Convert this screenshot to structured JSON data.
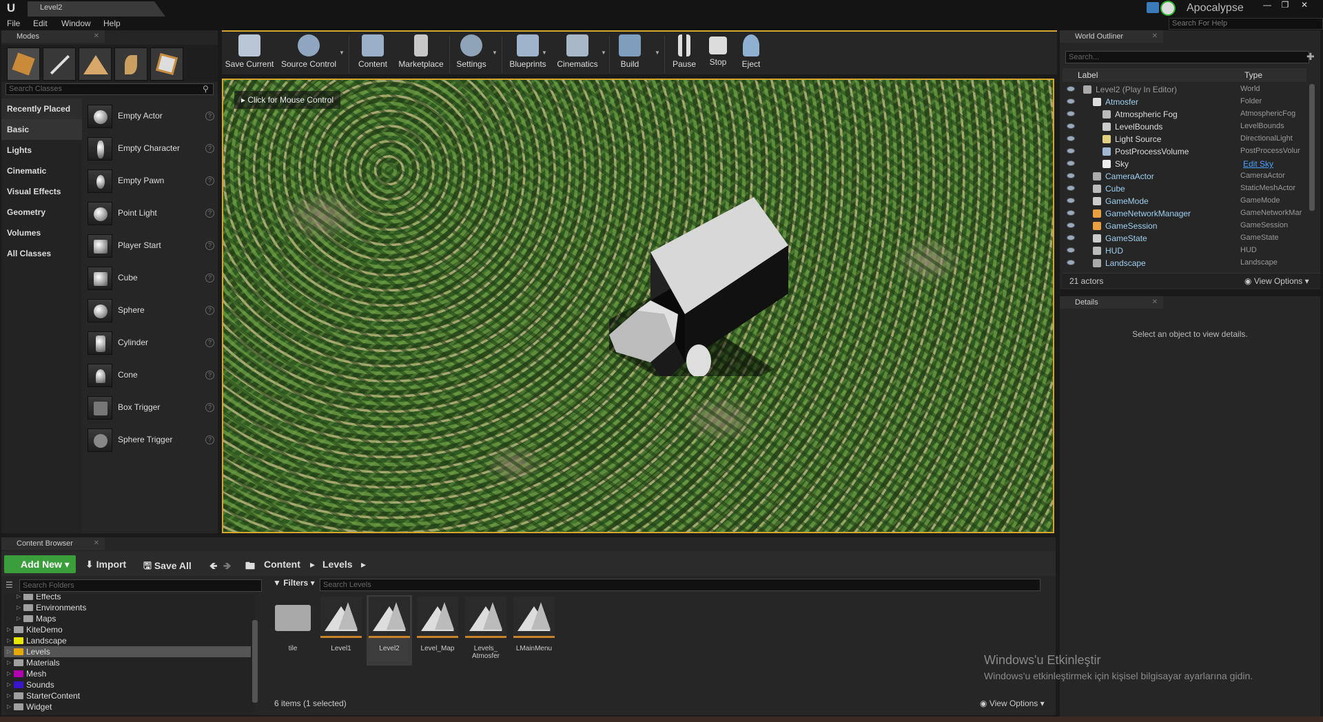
{
  "titlebar": {
    "level_tab": "Level2",
    "project": "Apocalypse",
    "help_search_placeholder": "Search For Help"
  },
  "menu": [
    "File",
    "Edit",
    "Window",
    "Help"
  ],
  "modes": {
    "tab": "Modes",
    "search_placeholder": "Search Classes",
    "categories": [
      "Recently Placed",
      "Basic",
      "Lights",
      "Cinematic",
      "Visual Effects",
      "Geometry",
      "Volumes",
      "All Classes"
    ],
    "selected_category": "Basic",
    "items": [
      "Empty Actor",
      "Empty Character",
      "Empty Pawn",
      "Point Light",
      "Player Start",
      "Cube",
      "Sphere",
      "Cylinder",
      "Cone",
      "Box Trigger",
      "Sphere Trigger"
    ]
  },
  "toolbar": [
    "Save Current",
    "Source Control",
    "Content",
    "Marketplace",
    "Settings",
    "Blueprints",
    "Cinematics",
    "Build",
    "Pause",
    "Stop",
    "Eject"
  ],
  "viewport": {
    "hint": "Click for Mouse Control"
  },
  "outliner": {
    "tab": "World Outliner",
    "search_placeholder": "Search...",
    "col_label": "Label",
    "col_type": "Type",
    "rows": [
      {
        "label": "Level2 (Play In Editor)",
        "type": "World",
        "indent": 0
      },
      {
        "label": "Atmosfer",
        "type": "Folder",
        "indent": 1
      },
      {
        "label": "Atmospheric Fog",
        "type": "AtmosphericFog",
        "indent": 2
      },
      {
        "label": "LevelBounds",
        "type": "LevelBounds",
        "indent": 2
      },
      {
        "label": "Light Source",
        "type": "DirectionalLight",
        "indent": 2
      },
      {
        "label": "PostProcessVolume",
        "type": "PostProcessVolur",
        "indent": 2
      },
      {
        "label": "Sky",
        "type": "Edit Sky",
        "indent": 2
      },
      {
        "label": "CameraActor",
        "type": "CameraActor",
        "indent": 1
      },
      {
        "label": "Cube",
        "type": "StaticMeshActor",
        "indent": 1
      },
      {
        "label": "GameMode",
        "type": "GameMode",
        "indent": 1
      },
      {
        "label": "GameNetworkManager",
        "type": "GameNetworkMar",
        "indent": 1
      },
      {
        "label": "GameSession",
        "type": "GameSession",
        "indent": 1
      },
      {
        "label": "GameState",
        "type": "GameState",
        "indent": 1
      },
      {
        "label": "HUD",
        "type": "HUD",
        "indent": 1
      },
      {
        "label": "Landscape",
        "type": "Landscape",
        "indent": 1
      }
    ],
    "count": "21 actors",
    "view_options": "View Options"
  },
  "details": {
    "tab": "Details",
    "message": "Select an object to view details."
  },
  "content_browser": {
    "tab": "Content Browser",
    "add_new": "Add New",
    "import": "Import",
    "save_all": "Save All",
    "breadcrumb": [
      "Content",
      "Levels"
    ],
    "folder_search_placeholder": "Search Folders",
    "filters": "Filters",
    "asset_search_placeholder": "Search Levels",
    "folders": [
      {
        "name": "Effects",
        "indent": 1,
        "color": "#a0a0a0"
      },
      {
        "name": "Environments",
        "indent": 1,
        "color": "#a0a0a0"
      },
      {
        "name": "Maps",
        "indent": 1,
        "color": "#a0a0a0"
      },
      {
        "name": "KiteDemo",
        "indent": 0,
        "color": "#a0a0a0"
      },
      {
        "name": "Landscape",
        "indent": 0,
        "color": "#e6e600"
      },
      {
        "name": "Levels",
        "indent": 0,
        "color": "#e6a800"
      },
      {
        "name": "Materials",
        "indent": 0,
        "color": "#a0a0a0"
      },
      {
        "name": "Mesh",
        "indent": 0,
        "color": "#b000b0"
      },
      {
        "name": "Sounds",
        "indent": 0,
        "color": "#3a14c8"
      },
      {
        "name": "StarterContent",
        "indent": 0,
        "color": "#a0a0a0"
      },
      {
        "name": "Widget",
        "indent": 0,
        "color": "#a0a0a0"
      }
    ],
    "selected_folder": "Levels",
    "assets": [
      "tile",
      "Level1",
      "Level2",
      "Level_Map",
      "Levels_ Atmosfer",
      "LMainMenu"
    ],
    "selected_asset": "Level2",
    "status": "6 items (1 selected)",
    "view_options": "View Options"
  },
  "watermark": {
    "line1": "Windows'u Etkinleştir",
    "line2": "Windows'u etkinleştirmek için kişisel bilgisayar ayarlarına gidin."
  }
}
